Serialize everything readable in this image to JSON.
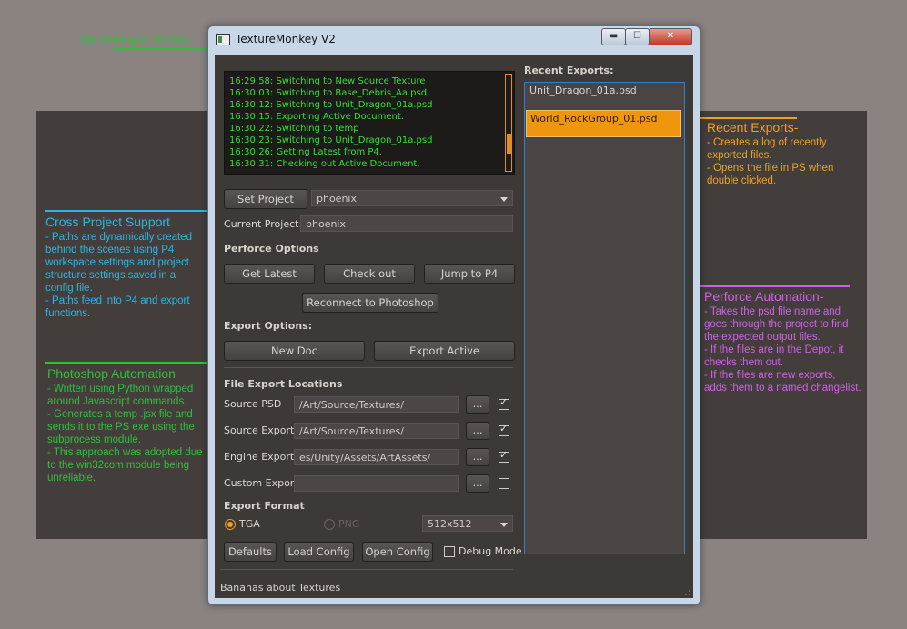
{
  "top_note": "Still working on an Icon...",
  "window": {
    "title": "TextureMonkey V2",
    "controls": {
      "minimize": "▬",
      "maximize": "☐",
      "close": "✕"
    }
  },
  "log": {
    "lines": [
      "16:29:58: Switching to New Source Texture",
      "16:30:03: Switching to Base_Debris_Aa.psd",
      "16:30:12: Switching to Unit_Dragon_01a.psd",
      "16:30:15: Exporting Active Document.",
      "16:30:22: Switching to temp",
      "16:30:23: Switching to Unit_Dragon_01a.psd",
      "16:30:26: Getting Latest from P4.",
      "16:30:31: Checking out Active Document."
    ]
  },
  "project": {
    "set_button": "Set Project",
    "selected": "phoenix",
    "current_label": "Current Project:",
    "current_value": "phoenix"
  },
  "perforce": {
    "header": "Perforce Options",
    "get_latest": "Get Latest",
    "check_out": "Check out",
    "jump": "Jump to P4",
    "reconnect": "Reconnect to Photoshop"
  },
  "export_options": {
    "header": "Export Options:",
    "new_doc": "New Doc",
    "export_active": "Export Active"
  },
  "locations": {
    "header": "File Export Locations",
    "browse": "...",
    "rows": [
      {
        "label": "Source PSD",
        "value": "/Art/Source/Textures/",
        "checked": true
      },
      {
        "label": "Source Export",
        "value": "/Art/Source/Textures/",
        "checked": true
      },
      {
        "label": "Engine Export",
        "value": "es/Unity/Assets/ArtAssets/",
        "checked": true
      },
      {
        "label": "Custom Export",
        "value": "",
        "checked": false
      }
    ]
  },
  "format": {
    "header": "Export Format",
    "tga": "TGA",
    "png": "PNG",
    "size": "512x512"
  },
  "bottom": {
    "defaults": "Defaults",
    "load_config": "Load Config",
    "open_config": "Open Config",
    "debug_mode": "Debug Mode"
  },
  "recent": {
    "header": "Recent Exports:",
    "items": [
      "Unit_Dragon_01a.psd",
      "World_RockGroup_01.psd"
    ]
  },
  "status": "Bananas about Textures",
  "annotations": {
    "cross_project": {
      "title": "Cross Project Support",
      "lines": [
        "- Paths are dynamically created",
        "behind the scenes using P4",
        "workspace settings and project",
        "structure settings saved in a",
        "config file.",
        "- Paths feed into P4 and export",
        "functions."
      ]
    },
    "photoshop": {
      "title": "Photoshop Automation",
      "lines": [
        "- Written using Python wrapped",
        "around Javascript commands.",
        "- Generates a temp .jsx file and",
        "sends it to the PS exe using the",
        "subprocess module.",
        "- This approach was adopted due",
        "to the win32com module being",
        "unreliable."
      ]
    },
    "recent_exports": {
      "title": "Recent Exports-",
      "lines": [
        "- Creates a log of recently",
        "exported files.",
        "- Opens the file in PS when",
        "double clicked."
      ]
    },
    "perforce_auto": {
      "title": "Perforce Automation-",
      "lines": [
        "- Takes the psd file name and",
        "goes through the project to find",
        "the expected output files.",
        "- If the files are in the Depot, it",
        "checks them out.",
        "- If the files are new exports,",
        "adds them to a named changelist."
      ]
    }
  },
  "colors": {
    "cyan": "#2ab6e8",
    "green": "#2fc03a",
    "orange": "#f0a020",
    "magenta": "#d060e8"
  }
}
